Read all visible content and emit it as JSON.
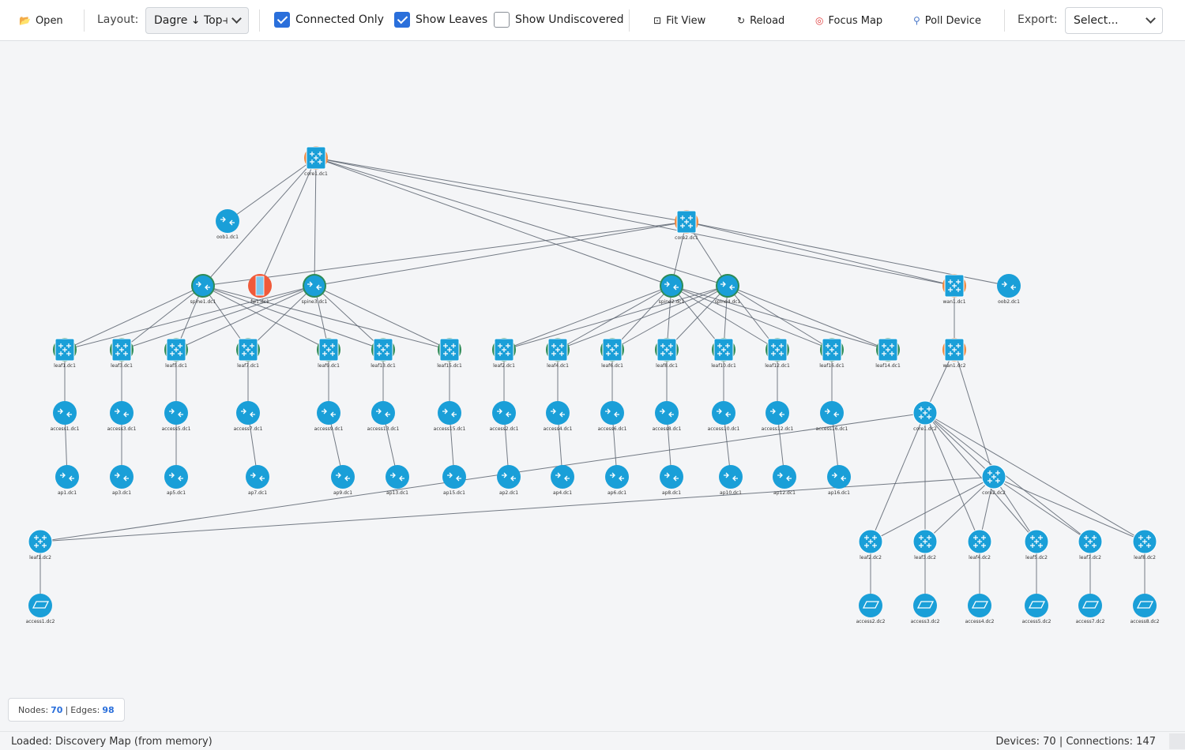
{
  "toolbar": {
    "open_label": "Open",
    "layout_label": "Layout:",
    "layout_value": "Dagre ↓ Top⫞",
    "connected_only": {
      "label": "Connected Only",
      "checked": true
    },
    "show_leaves": {
      "label": "Show Leaves",
      "checked": true
    },
    "show_undiscovered": {
      "label": "Show Undiscovered",
      "checked": false
    },
    "fit_view_label": "Fit View",
    "reload_label": "Reload",
    "focus_map_label": "Focus Map",
    "poll_device_label": "Poll Device",
    "export_label": "Export:",
    "export_value": "Select..."
  },
  "stats": {
    "nodes_label": "Nodes:",
    "nodes": "70",
    "sep": "|",
    "edges_label": "Edges:",
    "edges": "98"
  },
  "status": {
    "left": "Loaded: Discovery Map (from memory)",
    "right": "Devices: 70 | Connections: 147"
  },
  "colors": {
    "accent": "#2a6fdb",
    "device": "#1a9fd8",
    "ring_green": "#2e8b57",
    "ring_orange": "#f0883e",
    "firewall": "#f05a3a",
    "edge": "#5c6470"
  },
  "topology": {
    "nodes": [
      {
        "id": "core1.dc1",
        "type": "switch",
        "ring": "orange"
      },
      {
        "id": "oob1.dc1",
        "type": "router"
      },
      {
        "id": "core2.dc1",
        "type": "switch",
        "ring": "orange"
      },
      {
        "id": "spine1.dc1",
        "type": "router",
        "ring": "green"
      },
      {
        "id": "fw1.dc1",
        "type": "firewall"
      },
      {
        "id": "spine3.dc1",
        "type": "router",
        "ring": "green"
      },
      {
        "id": "spine2.dc1",
        "type": "router",
        "ring": "green"
      },
      {
        "id": "spine4.dc1",
        "type": "router",
        "ring": "green"
      },
      {
        "id": "wan1.dc1",
        "type": "switch",
        "ring": "orange"
      },
      {
        "id": "oob2.dc1",
        "type": "router"
      },
      {
        "id": "leaf1.dc1",
        "type": "switch",
        "ring": "green"
      },
      {
        "id": "leaf3.dc1",
        "type": "switch",
        "ring": "green"
      },
      {
        "id": "leaf5.dc1",
        "type": "switch",
        "ring": "green"
      },
      {
        "id": "leaf7.dc1",
        "type": "switch",
        "ring": "green"
      },
      {
        "id": "leaf9.dc1",
        "type": "switch",
        "ring": "green"
      },
      {
        "id": "leaf13.dc1",
        "type": "switch",
        "ring": "green"
      },
      {
        "id": "leaf15.dc1",
        "type": "switch",
        "ring": "green"
      },
      {
        "id": "leaf2.dc1",
        "type": "switch",
        "ring": "green"
      },
      {
        "id": "leaf4.dc1",
        "type": "switch",
        "ring": "green"
      },
      {
        "id": "leaf6.dc1",
        "type": "switch",
        "ring": "green"
      },
      {
        "id": "leaf8.dc1",
        "type": "switch",
        "ring": "green"
      },
      {
        "id": "leaf10.dc1",
        "type": "switch",
        "ring": "green"
      },
      {
        "id": "leaf12.dc1",
        "type": "switch",
        "ring": "green"
      },
      {
        "id": "leaf16.dc1",
        "type": "switch",
        "ring": "green"
      },
      {
        "id": "leaf14.dc1",
        "type": "switch",
        "ring": "green"
      },
      {
        "id": "wan1.dc2",
        "type": "switch",
        "ring": "orange"
      },
      {
        "id": "access1.dc1",
        "type": "router"
      },
      {
        "id": "access3.dc1",
        "type": "router"
      },
      {
        "id": "access5.dc1",
        "type": "router"
      },
      {
        "id": "access7.dc1",
        "type": "router"
      },
      {
        "id": "access9.dc1",
        "type": "router"
      },
      {
        "id": "access13.dc1",
        "type": "router"
      },
      {
        "id": "access15.dc1",
        "type": "router"
      },
      {
        "id": "access2.dc1",
        "type": "router"
      },
      {
        "id": "access4.dc1",
        "type": "router"
      },
      {
        "id": "access6.dc1",
        "type": "router"
      },
      {
        "id": "access8.dc1",
        "type": "router"
      },
      {
        "id": "access10.dc1",
        "type": "router"
      },
      {
        "id": "access12.dc1",
        "type": "router"
      },
      {
        "id": "access16.dc1",
        "type": "router"
      },
      {
        "id": "core1.dc2",
        "type": "switch"
      },
      {
        "id": "ap1.dc1",
        "type": "router"
      },
      {
        "id": "ap3.dc1",
        "type": "router"
      },
      {
        "id": "ap5.dc1",
        "type": "router"
      },
      {
        "id": "ap7.dc1",
        "type": "router"
      },
      {
        "id": "ap9.dc1",
        "type": "router"
      },
      {
        "id": "ap13.dc1",
        "type": "router"
      },
      {
        "id": "ap15.dc1",
        "type": "router"
      },
      {
        "id": "ap2.dc1",
        "type": "router"
      },
      {
        "id": "ap4.dc1",
        "type": "router"
      },
      {
        "id": "ap6.dc1",
        "type": "router"
      },
      {
        "id": "ap8.dc1",
        "type": "router"
      },
      {
        "id": "ap10.dc1",
        "type": "router"
      },
      {
        "id": "ap12.dc1",
        "type": "router"
      },
      {
        "id": "ap16.dc1",
        "type": "router"
      },
      {
        "id": "core2.dc2",
        "type": "switch"
      },
      {
        "id": "leaf1.dc2",
        "type": "switch"
      },
      {
        "id": "leaf2.dc2",
        "type": "switch"
      },
      {
        "id": "leaf3.dc2",
        "type": "switch"
      },
      {
        "id": "leaf4.dc2",
        "type": "switch"
      },
      {
        "id": "leaf5.dc2",
        "type": "switch"
      },
      {
        "id": "leaf7.dc2",
        "type": "switch"
      },
      {
        "id": "leaf8.dc2",
        "type": "switch"
      },
      {
        "id": "access1.dc2",
        "type": "ap"
      },
      {
        "id": "access2.dc2",
        "type": "ap"
      },
      {
        "id": "access3.dc2",
        "type": "ap"
      },
      {
        "id": "access4.dc2",
        "type": "ap"
      },
      {
        "id": "access5.dc2",
        "type": "ap"
      },
      {
        "id": "access7.dc2",
        "type": "ap"
      },
      {
        "id": "access8.dc2",
        "type": "ap"
      }
    ],
    "edges": [
      [
        "core1.dc1",
        "oob1.dc1"
      ],
      [
        "core1.dc1",
        "core2.dc1"
      ],
      [
        "core1.dc1",
        "spine1.dc1"
      ],
      [
        "core1.dc1",
        "fw1.dc1"
      ],
      [
        "core1.dc1",
        "spine3.dc1"
      ],
      [
        "core1.dc1",
        "spine2.dc1"
      ],
      [
        "core1.dc1",
        "spine4.dc1"
      ],
      [
        "core1.dc1",
        "wan1.dc1"
      ],
      [
        "core2.dc1",
        "spine1.dc1"
      ],
      [
        "core2.dc1",
        "spine3.dc1"
      ],
      [
        "core2.dc1",
        "spine2.dc1"
      ],
      [
        "core2.dc1",
        "spine4.dc1"
      ],
      [
        "core2.dc1",
        "wan1.dc1"
      ],
      [
        "core2.dc1",
        "oob2.dc1"
      ],
      [
        "spine1.dc1",
        "leaf1.dc1"
      ],
      [
        "spine1.dc1",
        "leaf3.dc1"
      ],
      [
        "spine1.dc1",
        "leaf5.dc1"
      ],
      [
        "spine1.dc1",
        "leaf7.dc1"
      ],
      [
        "spine1.dc1",
        "leaf9.dc1"
      ],
      [
        "spine1.dc1",
        "leaf13.dc1"
      ],
      [
        "spine1.dc1",
        "leaf15.dc1"
      ],
      [
        "spine3.dc1",
        "leaf1.dc1"
      ],
      [
        "spine3.dc1",
        "leaf3.dc1"
      ],
      [
        "spine3.dc1",
        "leaf5.dc1"
      ],
      [
        "spine3.dc1",
        "leaf7.dc1"
      ],
      [
        "spine3.dc1",
        "leaf9.dc1"
      ],
      [
        "spine3.dc1",
        "leaf13.dc1"
      ],
      [
        "spine3.dc1",
        "leaf15.dc1"
      ],
      [
        "spine2.dc1",
        "leaf2.dc1"
      ],
      [
        "spine2.dc1",
        "leaf4.dc1"
      ],
      [
        "spine2.dc1",
        "leaf6.dc1"
      ],
      [
        "spine2.dc1",
        "leaf8.dc1"
      ],
      [
        "spine2.dc1",
        "leaf10.dc1"
      ],
      [
        "spine2.dc1",
        "leaf12.dc1"
      ],
      [
        "spine2.dc1",
        "leaf16.dc1"
      ],
      [
        "spine2.dc1",
        "leaf14.dc1"
      ],
      [
        "spine4.dc1",
        "leaf2.dc1"
      ],
      [
        "spine4.dc1",
        "leaf4.dc1"
      ],
      [
        "spine4.dc1",
        "leaf6.dc1"
      ],
      [
        "spine4.dc1",
        "leaf8.dc1"
      ],
      [
        "spine4.dc1",
        "leaf10.dc1"
      ],
      [
        "spine4.dc1",
        "leaf12.dc1"
      ],
      [
        "spine4.dc1",
        "leaf16.dc1"
      ],
      [
        "spine4.dc1",
        "leaf14.dc1"
      ],
      [
        "wan1.dc1",
        "wan1.dc2"
      ],
      [
        "leaf1.dc1",
        "access1.dc1"
      ],
      [
        "leaf3.dc1",
        "access3.dc1"
      ],
      [
        "leaf5.dc1",
        "access5.dc1"
      ],
      [
        "leaf7.dc1",
        "access7.dc1"
      ],
      [
        "leaf9.dc1",
        "access9.dc1"
      ],
      [
        "leaf13.dc1",
        "access13.dc1"
      ],
      [
        "leaf15.dc1",
        "access15.dc1"
      ],
      [
        "leaf2.dc1",
        "access2.dc1"
      ],
      [
        "leaf4.dc1",
        "access4.dc1"
      ],
      [
        "leaf6.dc1",
        "access6.dc1"
      ],
      [
        "leaf8.dc1",
        "access8.dc1"
      ],
      [
        "leaf10.dc1",
        "access10.dc1"
      ],
      [
        "leaf12.dc1",
        "access12.dc1"
      ],
      [
        "leaf16.dc1",
        "access16.dc1"
      ],
      [
        "access1.dc1",
        "ap1.dc1"
      ],
      [
        "access3.dc1",
        "ap3.dc1"
      ],
      [
        "access5.dc1",
        "ap5.dc1"
      ],
      [
        "access7.dc1",
        "ap7.dc1"
      ],
      [
        "access9.dc1",
        "ap9.dc1"
      ],
      [
        "access13.dc1",
        "ap13.dc1"
      ],
      [
        "access15.dc1",
        "ap15.dc1"
      ],
      [
        "access2.dc1",
        "ap2.dc1"
      ],
      [
        "access4.dc1",
        "ap4.dc1"
      ],
      [
        "access6.dc1",
        "ap6.dc1"
      ],
      [
        "access8.dc1",
        "ap8.dc1"
      ],
      [
        "access10.dc1",
        "ap10.dc1"
      ],
      [
        "access12.dc1",
        "ap12.dc1"
      ],
      [
        "access16.dc1",
        "ap16.dc1"
      ],
      [
        "wan1.dc2",
        "core1.dc2"
      ],
      [
        "wan1.dc2",
        "core2.dc2"
      ],
      [
        "core1.dc2",
        "core2.dc2"
      ],
      [
        "core1.dc2",
        "leaf1.dc2"
      ],
      [
        "core2.dc2",
        "leaf1.dc2"
      ],
      [
        "core1.dc2",
        "leaf2.dc2"
      ],
      [
        "core1.dc2",
        "leaf3.dc2"
      ],
      [
        "core1.dc2",
        "leaf4.dc2"
      ],
      [
        "core1.dc2",
        "leaf5.dc2"
      ],
      [
        "core1.dc2",
        "leaf7.dc2"
      ],
      [
        "core1.dc2",
        "leaf8.dc2"
      ],
      [
        "core2.dc2",
        "leaf2.dc2"
      ],
      [
        "core2.dc2",
        "leaf3.dc2"
      ],
      [
        "core2.dc2",
        "leaf4.dc2"
      ],
      [
        "core2.dc2",
        "leaf5.dc2"
      ],
      [
        "core2.dc2",
        "leaf7.dc2"
      ],
      [
        "core2.dc2",
        "leaf8.dc2"
      ],
      [
        "leaf1.dc2",
        "access1.dc2"
      ],
      [
        "leaf2.dc2",
        "access2.dc2"
      ],
      [
        "leaf3.dc2",
        "access3.dc2"
      ],
      [
        "leaf4.dc2",
        "access4.dc2"
      ],
      [
        "leaf5.dc2",
        "access5.dc2"
      ],
      [
        "leaf7.dc2",
        "access7.dc2"
      ],
      [
        "leaf8.dc2",
        "access8.dc2"
      ]
    ]
  }
}
